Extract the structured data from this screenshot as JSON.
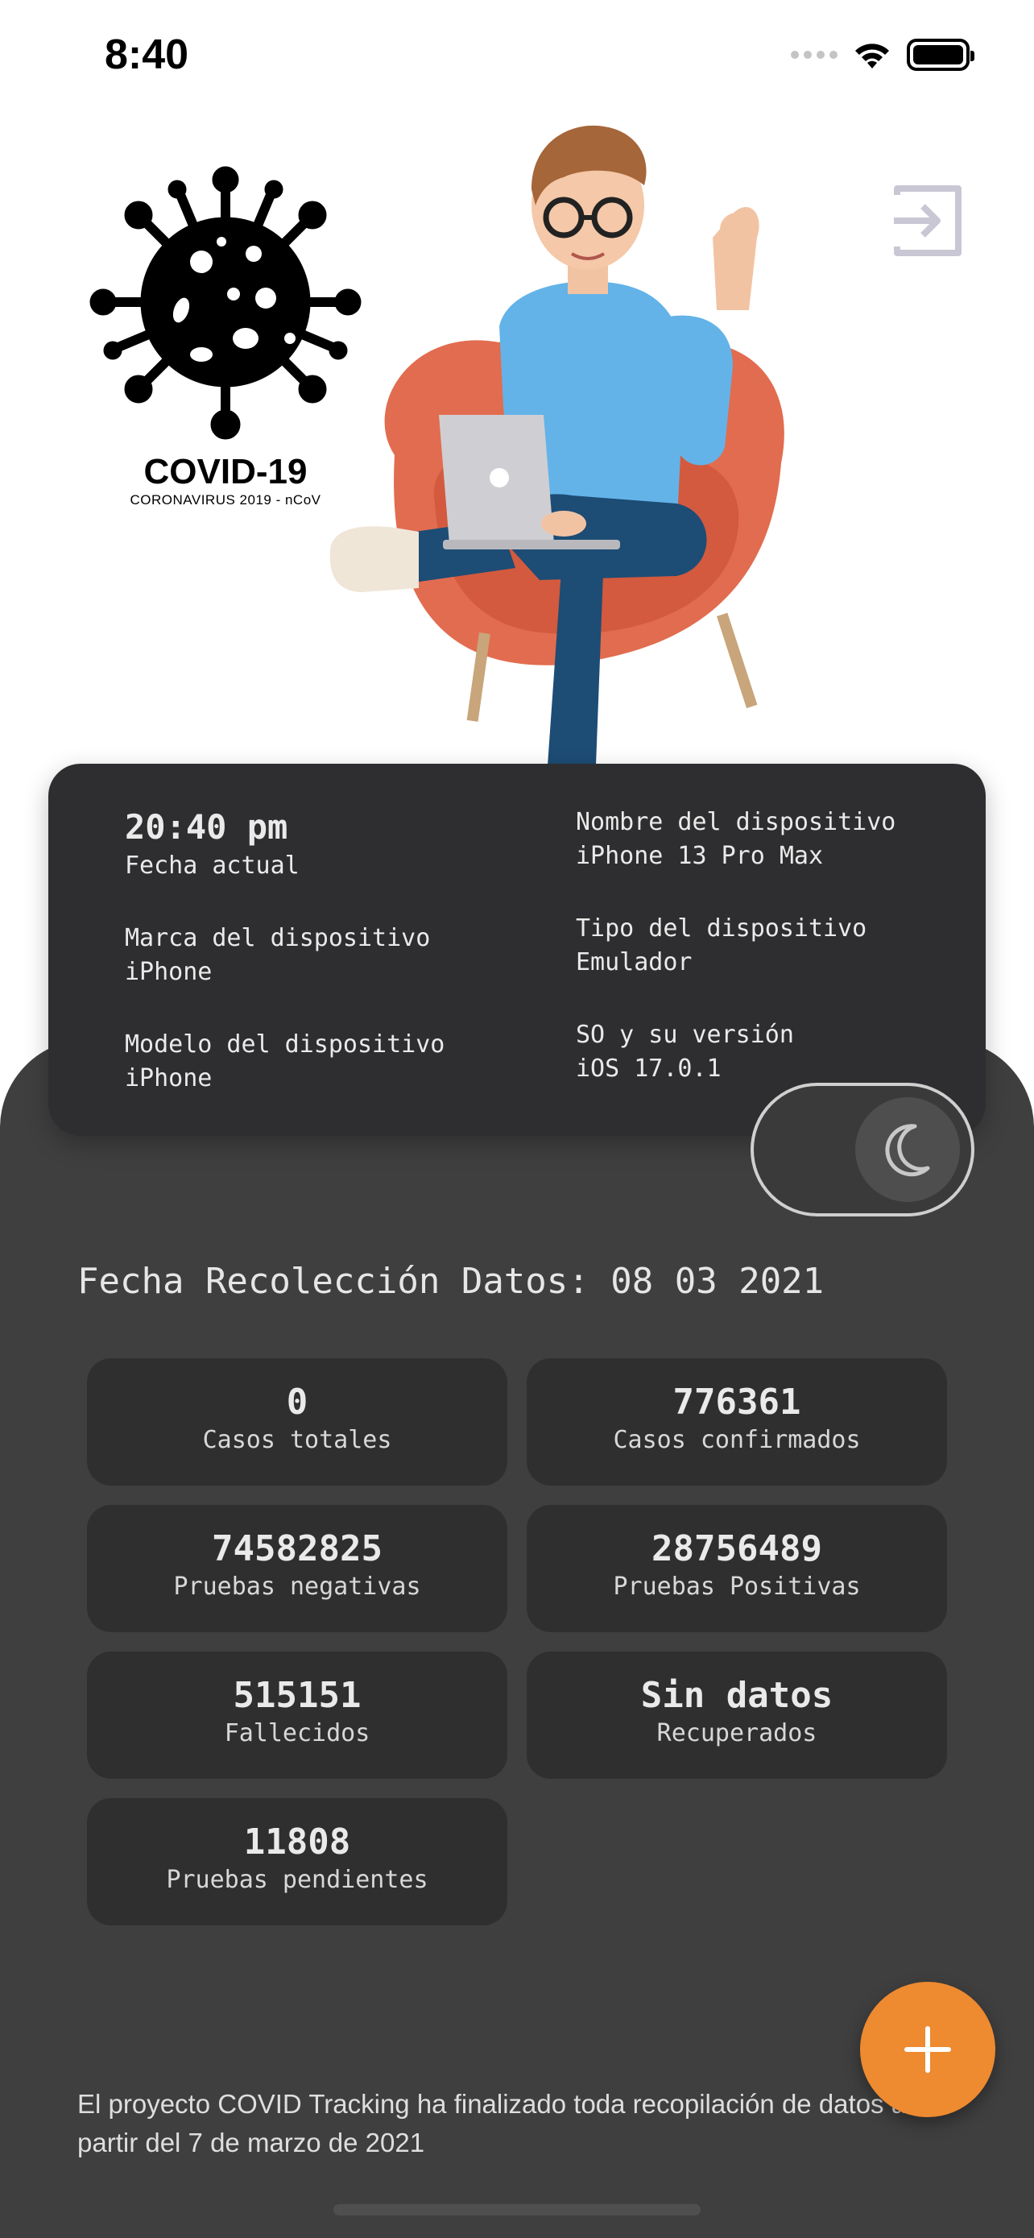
{
  "status_bar": {
    "time": "8:40"
  },
  "hero": {
    "logo_title": "COVID-19",
    "logo_subtitle": "CORONAVIRUS 2019 - nCoV",
    "logout_icon": "logout-icon",
    "illustration": "person-with-laptop-illustration"
  },
  "device_info": {
    "current_time": "20:40 pm",
    "current_time_label": "Fecha actual",
    "brand_label": "Marca del dispositivo",
    "brand_value": "iPhone",
    "model_label": "Modelo del dispositivo",
    "model_value": "iPhone",
    "name_label": "Nombre del dispositivo",
    "name_value": "iPhone 13 Pro Max",
    "type_label": "Tipo del dispositivo",
    "type_value": "Emulador",
    "os_label": "SO y su versión",
    "os_value": "iOS 17.0.1"
  },
  "theme_toggle": {
    "icon": "moon-icon",
    "state": "dark"
  },
  "data_date": "Fecha Recolección Datos: 08 03 2021",
  "stats": [
    {
      "value": "0",
      "label": "Casos totales"
    },
    {
      "value": "776361",
      "label": "Casos confirmados"
    },
    {
      "value": "74582825",
      "label": "Pruebas negativas"
    },
    {
      "value": "28756489",
      "label": "Pruebas Positivas"
    },
    {
      "value": "515151",
      "label": "Fallecidos"
    },
    {
      "value": "Sin datos",
      "label": "Recuperados"
    },
    {
      "value": "11808",
      "label": "Pruebas pendientes"
    }
  ],
  "footer_note": {
    "line1": "El proyecto COVID Tracking ha finalizado toda recopilación de datos a",
    "line2": "partir del 7 de marzo de 2021"
  },
  "fab": {
    "icon": "plus-icon"
  },
  "colors": {
    "accent": "#ee8a30",
    "panel": "#3f3f3f",
    "card": "#2e2e30",
    "stat": "#2f2f2f"
  }
}
